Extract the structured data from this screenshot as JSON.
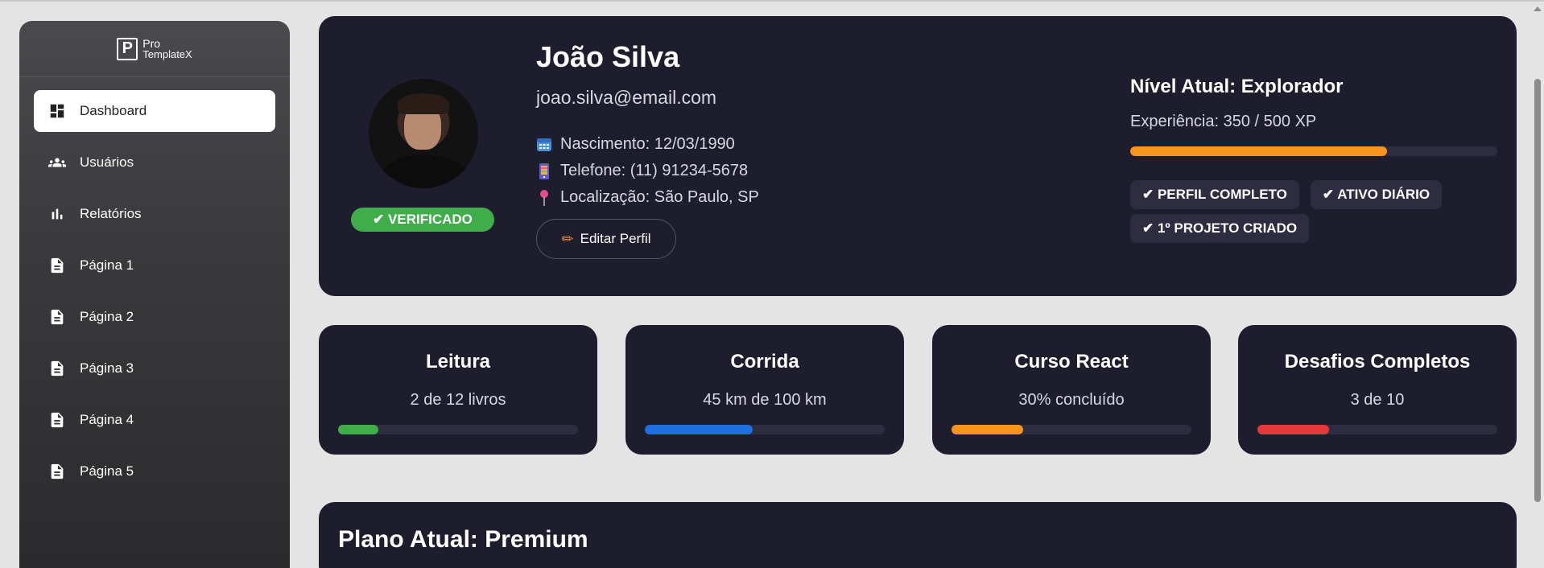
{
  "brand": {
    "line1": "Pro",
    "line2": "TemplateX",
    "mark": "P"
  },
  "sidebar": {
    "items": [
      {
        "label": "Dashboard",
        "icon": "dashboard-icon",
        "active": true
      },
      {
        "label": "Usuários",
        "icon": "users-icon"
      },
      {
        "label": "Relatórios",
        "icon": "bar-chart-icon"
      },
      {
        "label": "Página 1",
        "icon": "document-icon"
      },
      {
        "label": "Página 2",
        "icon": "document-icon"
      },
      {
        "label": "Página 3",
        "icon": "document-icon"
      },
      {
        "label": "Página 4",
        "icon": "document-icon"
      },
      {
        "label": "Página 5",
        "icon": "document-icon"
      }
    ]
  },
  "profile": {
    "name": "João Silva",
    "email": "joao.silva@email.com",
    "verified": "✔ VERIFICADO",
    "birth": "Nascimento: 12/03/1990",
    "phone": "Telefone: (11) 91234-5678",
    "location": "Localização: São Paulo, SP",
    "edit_label": "Editar Perfil",
    "level_title": "Nível Atual: Explorador",
    "xp_text": "Experiência: 350 / 500 XP",
    "xp_fraction": 0.7,
    "badges": [
      "✔ PERFIL COMPLETO",
      "✔ ATIVO DIÁRIO",
      "✔ 1º PROJETO CRIADO"
    ]
  },
  "goals": [
    {
      "title": "Leitura",
      "text": "2 de 12 livros",
      "progress": 0.1667,
      "color": "#3fae4a"
    },
    {
      "title": "Corrida",
      "text": "45 km de 100 km",
      "progress": 0.45,
      "color": "#1f6fe0"
    },
    {
      "title": "Curso React",
      "text": "30% concluído",
      "progress": 0.3,
      "color": "#f7941d"
    },
    {
      "title": "Desafios Completos",
      "text": "3 de 10",
      "progress": 0.3,
      "color": "#e5383b"
    }
  ],
  "plan": {
    "title": "Plano Atual: Premium"
  },
  "colors": {
    "card_bg": "#1e1d2e",
    "verified": "#3fae4a",
    "xp": "#f7941d"
  }
}
